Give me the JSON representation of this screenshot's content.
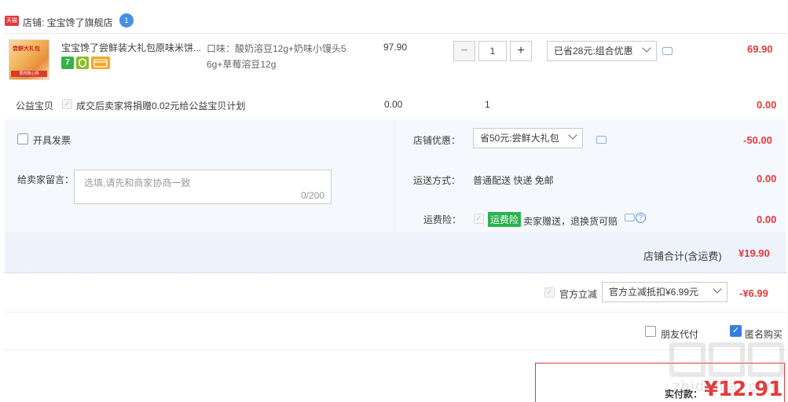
{
  "shop": {
    "badge": "天猫",
    "label": "店铺: 宝宝馋了旗舰店",
    "chat_badge": "1"
  },
  "item": {
    "thumb_text": "尝鲜大礼包",
    "thumb_strip": "限时随心购",
    "title": "宝宝馋了尝鲜装大礼包原味米饼...",
    "service_icons": [
      "seven-day-return-icon",
      "guarantee-icon",
      "credit-card-icon"
    ],
    "svc_7": "7",
    "sku_line1": "口味：酸奶溶豆12g+奶味小馒头5",
    "sku_line2": "6g+草莓溶豆12g",
    "unit_price": "97.90",
    "quantity": "1",
    "promo": "已省28元:组合优惠",
    "subtotal": "69.90"
  },
  "charity": {
    "label": "公益宝贝",
    "text": "成交后卖家将捐赠0.02元给公益宝贝计划",
    "price": "0.00",
    "qty": "1",
    "subtotal": "0.00"
  },
  "invoice": {
    "label": "开具发票"
  },
  "message": {
    "label": "给卖家留言：",
    "placeholder": "选填,请先和商家协商一致",
    "counter": "0/200"
  },
  "shop_discount": {
    "label": "店铺优惠：",
    "value": "省50元:尝鲜大礼包",
    "amount": "-50.00"
  },
  "shipping": {
    "label": "运送方式：",
    "value": "普通配送 快递 免邮",
    "amount": "0.00"
  },
  "insurance": {
    "label": "运费险：",
    "tag": "运费险",
    "text": "卖家赠送，退换货可赔",
    "amount": "0.00"
  },
  "shop_total": {
    "label": "店铺合计(含运费)",
    "amount": "¥19.90"
  },
  "official_discount": {
    "label": "官方立减",
    "value": "官方立减抵扣¥6.99元",
    "amount": "-¥6.99"
  },
  "options": {
    "friend_pay": "朋友代付",
    "anonymous": "匿名购买"
  },
  "payment": {
    "label": "实付款：",
    "amount": "¥12.91"
  },
  "watermark": {
    "sub": "zhidemai.com"
  },
  "colors": {
    "accent_red": "#e4393c",
    "panel_bg": "#eef3fb",
    "checkbox_blue": "#3b7ddd",
    "tag_green": "#2bb24c"
  }
}
